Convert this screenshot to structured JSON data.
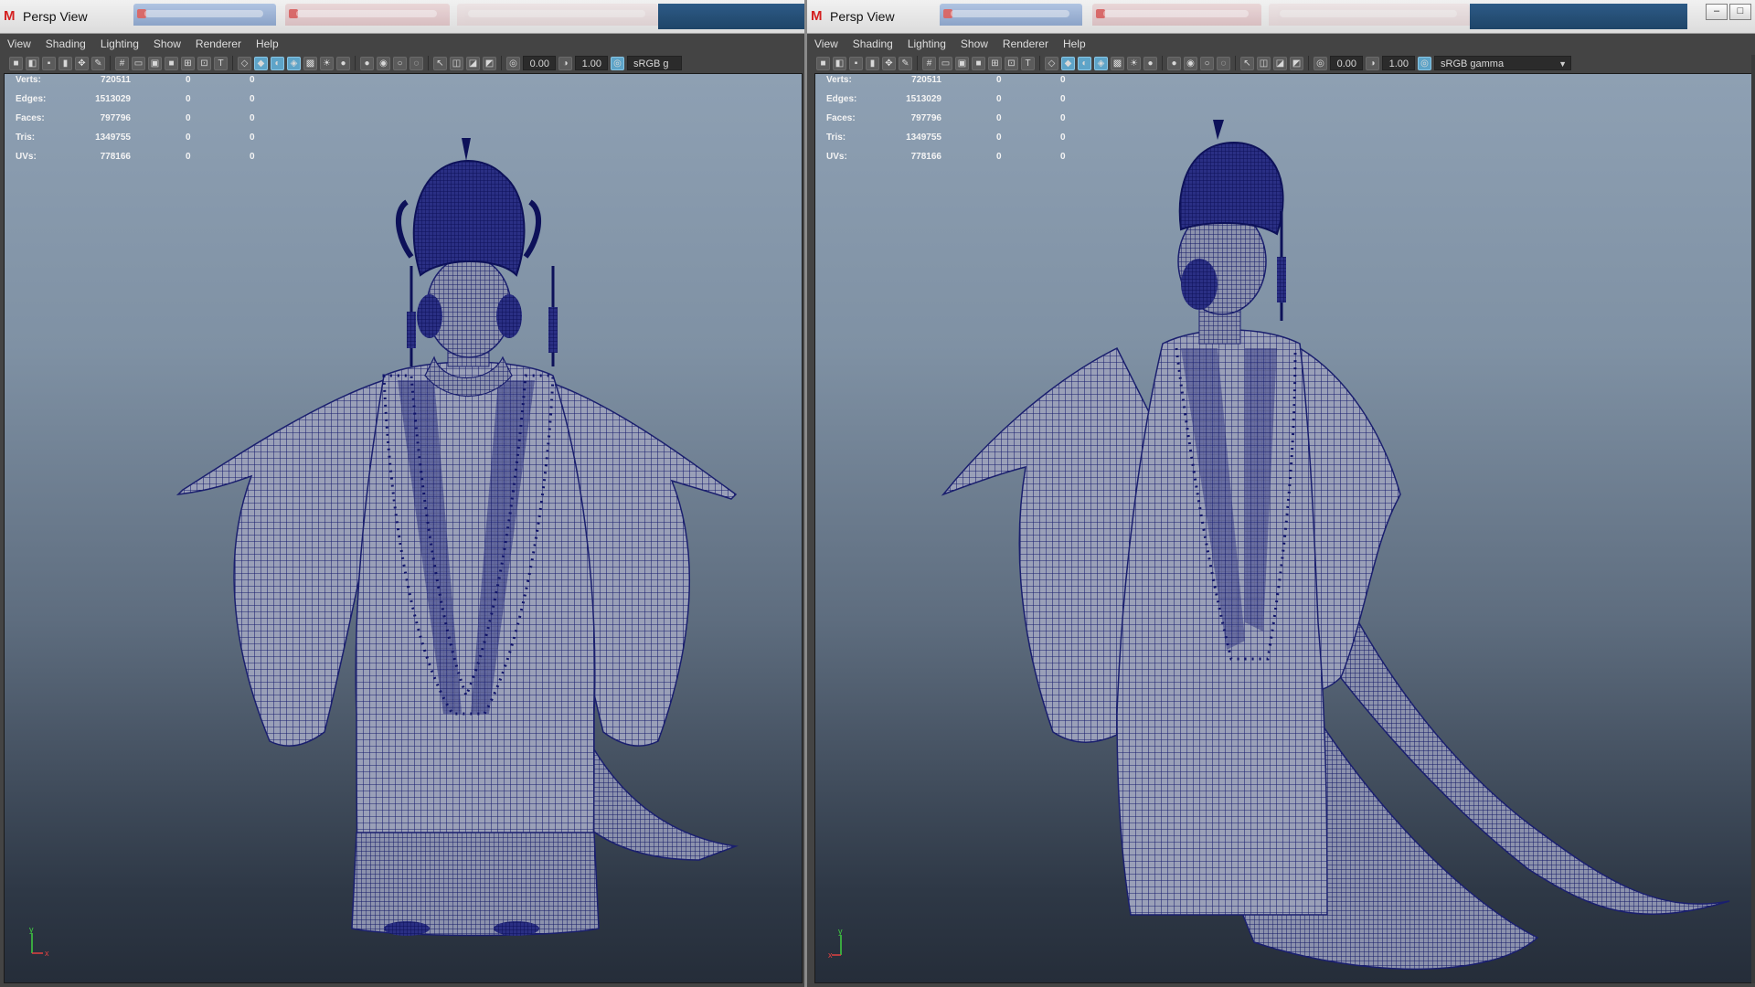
{
  "colors": {
    "wire": "#1a1f6e",
    "mesh_fill": "#9aa0b8",
    "accent_blue": "#5ea4c8",
    "maya_red": "#d42020"
  },
  "icons": {
    "app": "maya-logo-icon",
    "axis": "xyz-axis-icon"
  },
  "left": {
    "title": "Persp View",
    "app_letter": "M",
    "menu": [
      "View",
      "Shading",
      "Lighting",
      "Show",
      "Renderer",
      "Help"
    ],
    "exposure": "0.00",
    "gamma": "1.00",
    "color_space": "sRGB g",
    "hud": [
      {
        "label": "Verts:",
        "v1": "720511",
        "v2": "0",
        "v3": "0"
      },
      {
        "label": "Edges:",
        "v1": "1513029",
        "v2": "0",
        "v3": "0"
      },
      {
        "label": "Faces:",
        "v1": "797796",
        "v2": "0",
        "v3": "0"
      },
      {
        "label": "Tris:",
        "v1": "1349755",
        "v2": "0",
        "v3": "0"
      },
      {
        "label": "UVs:",
        "v1": "778166",
        "v2": "0",
        "v3": "0"
      }
    ],
    "axis_x": "x",
    "axis_y": "y"
  },
  "right": {
    "title": "Persp View",
    "app_letter": "M",
    "menu": [
      "View",
      "Shading",
      "Lighting",
      "Show",
      "Renderer",
      "Help"
    ],
    "exposure": "0.00",
    "gamma": "1.00",
    "color_space": "sRGB gamma",
    "hud": [
      {
        "label": "Verts:",
        "v1": "720511",
        "v2": "0",
        "v3": "0"
      },
      {
        "label": "Edges:",
        "v1": "1513029",
        "v2": "0",
        "v3": "0"
      },
      {
        "label": "Faces:",
        "v1": "797796",
        "v2": "0",
        "v3": "0"
      },
      {
        "label": "Tris:",
        "v1": "1349755",
        "v2": "0",
        "v3": "0"
      },
      {
        "label": "UVs:",
        "v1": "778166",
        "v2": "0",
        "v3": "0"
      }
    ],
    "axis_x": "x",
    "axis_y": "y"
  }
}
